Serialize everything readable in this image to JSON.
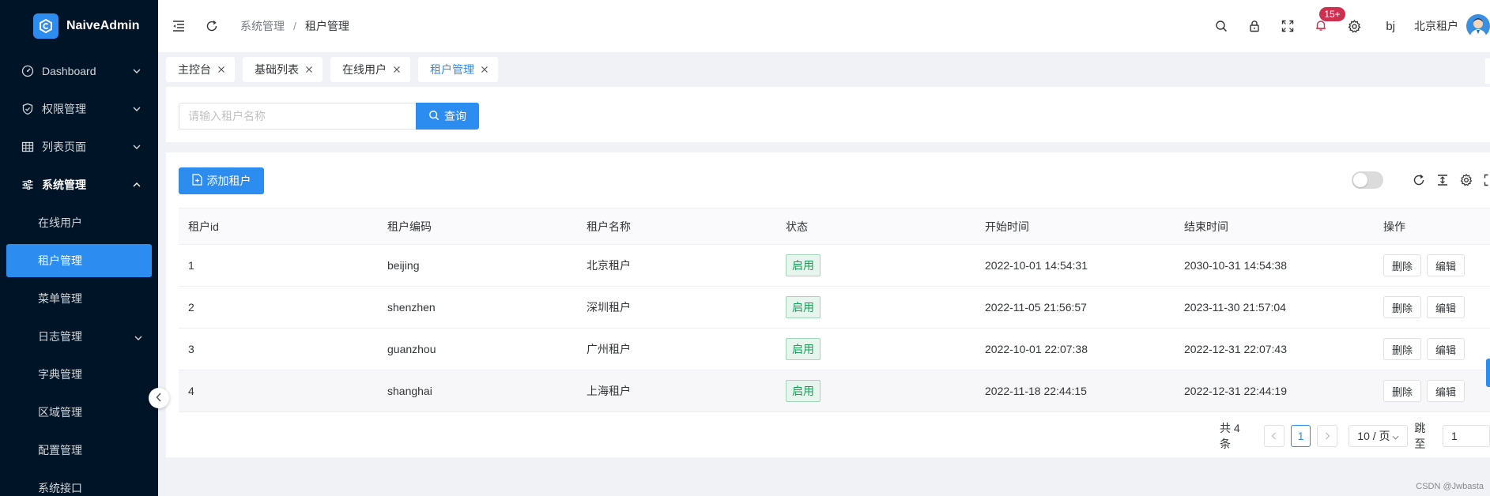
{
  "app": {
    "name": "NaiveAdmin"
  },
  "sidebar": {
    "items": [
      {
        "label": "Dashboard",
        "icon": "dashboard-icon"
      },
      {
        "label": "权限管理",
        "icon": "shield-icon"
      },
      {
        "label": "列表页面",
        "icon": "table-icon"
      },
      {
        "label": "系统管理",
        "icon": "sliders-icon"
      }
    ],
    "sub_items": [
      {
        "label": "在线用户"
      },
      {
        "label": "租户管理",
        "active": true
      },
      {
        "label": "菜单管理"
      },
      {
        "label": "日志管理",
        "has_children": true
      },
      {
        "label": "字典管理"
      },
      {
        "label": "区域管理"
      },
      {
        "label": "配置管理"
      },
      {
        "label": "系统接口"
      }
    ]
  },
  "header": {
    "breadcrumb": [
      "系统管理",
      "租户管理"
    ],
    "notification_badge": "15+",
    "language": "bj",
    "username": "北京租户"
  },
  "tabs": [
    {
      "label": "主控台"
    },
    {
      "label": "基础列表"
    },
    {
      "label": "在线用户"
    },
    {
      "label": "租户管理",
      "active": true
    }
  ],
  "search": {
    "placeholder": "请输入租户名称",
    "button_label": "查询"
  },
  "table_toolbar": {
    "add_button_label": "添加租户"
  },
  "table": {
    "columns": [
      "租户id",
      "租户编码",
      "租户名称",
      "状态",
      "开始时间",
      "结束时间",
      "操作"
    ],
    "rows": [
      {
        "id": "1",
        "code": "beijing",
        "name": "北京租户",
        "status": "启用",
        "start": "2022-10-01 14:54:31",
        "end": "2030-10-31 14:54:38"
      },
      {
        "id": "2",
        "code": "shenzhen",
        "name": "深圳租户",
        "status": "启用",
        "start": "2022-11-05 21:56:57",
        "end": "2023-11-30 21:57:04"
      },
      {
        "id": "3",
        "code": "guanzhou",
        "name": "广州租户",
        "status": "启用",
        "start": "2022-10-01 22:07:38",
        "end": "2022-12-31 22:07:43"
      },
      {
        "id": "4",
        "code": "shanghai",
        "name": "上海租户",
        "status": "启用",
        "start": "2022-11-18 22:44:15",
        "end": "2022-12-31 22:44:19"
      }
    ],
    "delete_label": "删除",
    "edit_label": "编辑"
  },
  "pagination": {
    "total_text": "共 4 条",
    "current_page": "1",
    "page_size": "10 / 页",
    "jump_label": "跳至",
    "jump_value": "1"
  },
  "watermark": "CSDN @Jwbasta",
  "colors": {
    "primary": "#2d8cf0",
    "sidebar_bg": "#001428",
    "success": "#18a058",
    "badge": "#d03050"
  }
}
